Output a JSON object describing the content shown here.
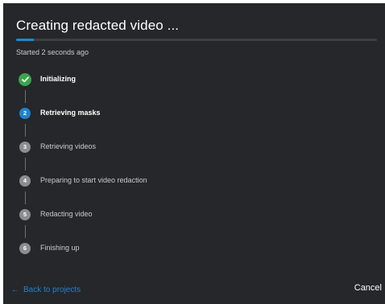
{
  "dialog": {
    "title": "Creating redacted video ...",
    "progress_percent": 5,
    "progress_color": "#1e88d0",
    "started_text": "Started 2 seconds ago"
  },
  "steps": [
    {
      "number": "1",
      "label": "Initializing",
      "status": "done",
      "icon": "check-icon",
      "color": "#3aa54a"
    },
    {
      "number": "2",
      "label": "Retrieving masks",
      "status": "active",
      "color": "#1f84cc"
    },
    {
      "number": "3",
      "label": "Retrieving videos",
      "status": "pending",
      "color": "#8a8d91"
    },
    {
      "number": "4",
      "label": "Preparing to start video redaction",
      "status": "pending",
      "color": "#8a8d91"
    },
    {
      "number": "5",
      "label": "Redacting video",
      "status": "pending",
      "color": "#8a8d91"
    },
    {
      "number": "6",
      "label": "Finishing up",
      "status": "pending",
      "color": "#8a8d91"
    }
  ],
  "footer": {
    "back_arrow": "←",
    "back_label": "Back to projects",
    "cancel_label": "Cancel"
  }
}
